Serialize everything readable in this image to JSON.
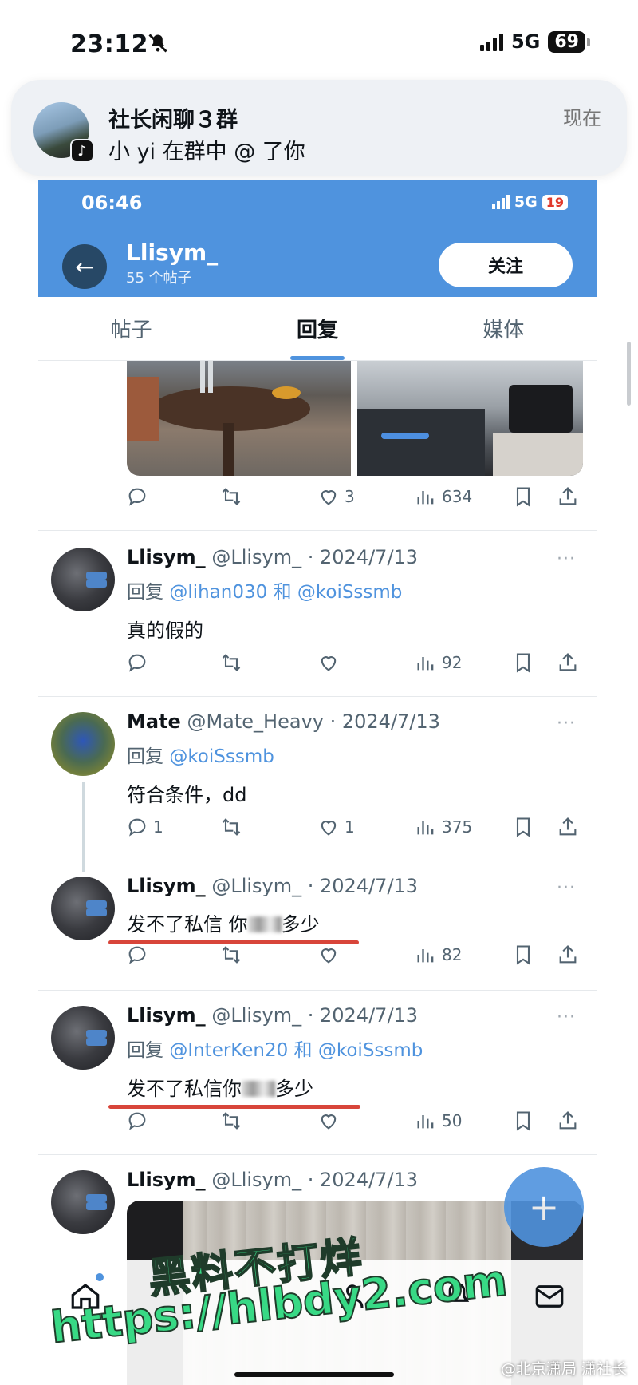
{
  "outer_status": {
    "time": "23:12",
    "network": "5G",
    "battery": "69"
  },
  "notification": {
    "title": "社长闲聊３群",
    "text": "小 yi 在群中 @ 了你",
    "time": "现在"
  },
  "inner_status": {
    "time": "06:46",
    "network": "5G",
    "battery": "19"
  },
  "profile": {
    "name": "Llisym_",
    "posts": "55 个帖子",
    "follow_label": "关注"
  },
  "tabs": [
    {
      "label": "帖子",
      "active": false
    },
    {
      "label": "回复",
      "active": true
    },
    {
      "label": "媒体",
      "active": false
    }
  ],
  "top_actions": {
    "likes": "3",
    "views": "634"
  },
  "tweets": [
    {
      "name": "Llisym_",
      "meta": "@Llisym_ · 2024/7/13",
      "reply_prefix": "回复",
      "reply_to_1": "@lihan030",
      "reply_and": "和",
      "reply_to_2": "@koiSssmb",
      "body": "真的假的",
      "replies": "",
      "likes": "",
      "views": "92"
    },
    {
      "name": "Mate",
      "meta": "@Mate_Heavy · 2024/7/13",
      "reply_prefix": "回复",
      "reply_to_1": "@koiSssmb",
      "body": "符合条件，dd",
      "replies": "1",
      "likes": "1",
      "views": "375"
    },
    {
      "name": "Llisym_",
      "meta": "@Llisym_ · 2024/7/13",
      "body_a": "发不了私信 你",
      "body_b": "多少",
      "replies": "",
      "likes": "",
      "views": "82"
    },
    {
      "name": "Llisym_",
      "meta": "@Llisym_ · 2024/7/13",
      "reply_prefix": "回复",
      "reply_to_1": "@InterKen20",
      "reply_and": "和",
      "reply_to_2": "@koiSssmb",
      "body_a": "发不了私信你",
      "body_b": "多少",
      "replies": "",
      "likes": "",
      "views": "50"
    },
    {
      "name": "Llisym_",
      "meta": "@Llisym_ · 2024/7/13"
    }
  ],
  "more_glyph": "···",
  "fab_label": "+",
  "watermark": {
    "line1": "黑料不打烊",
    "line2": "https://hlbdy2.com"
  },
  "weibo_credit": "@北京潇局  潇社长",
  "colors": {
    "accent": "#4f93de",
    "header_blue": "#4f93de",
    "underline_red": "#d8453a",
    "watermark_green": "#38d985"
  }
}
